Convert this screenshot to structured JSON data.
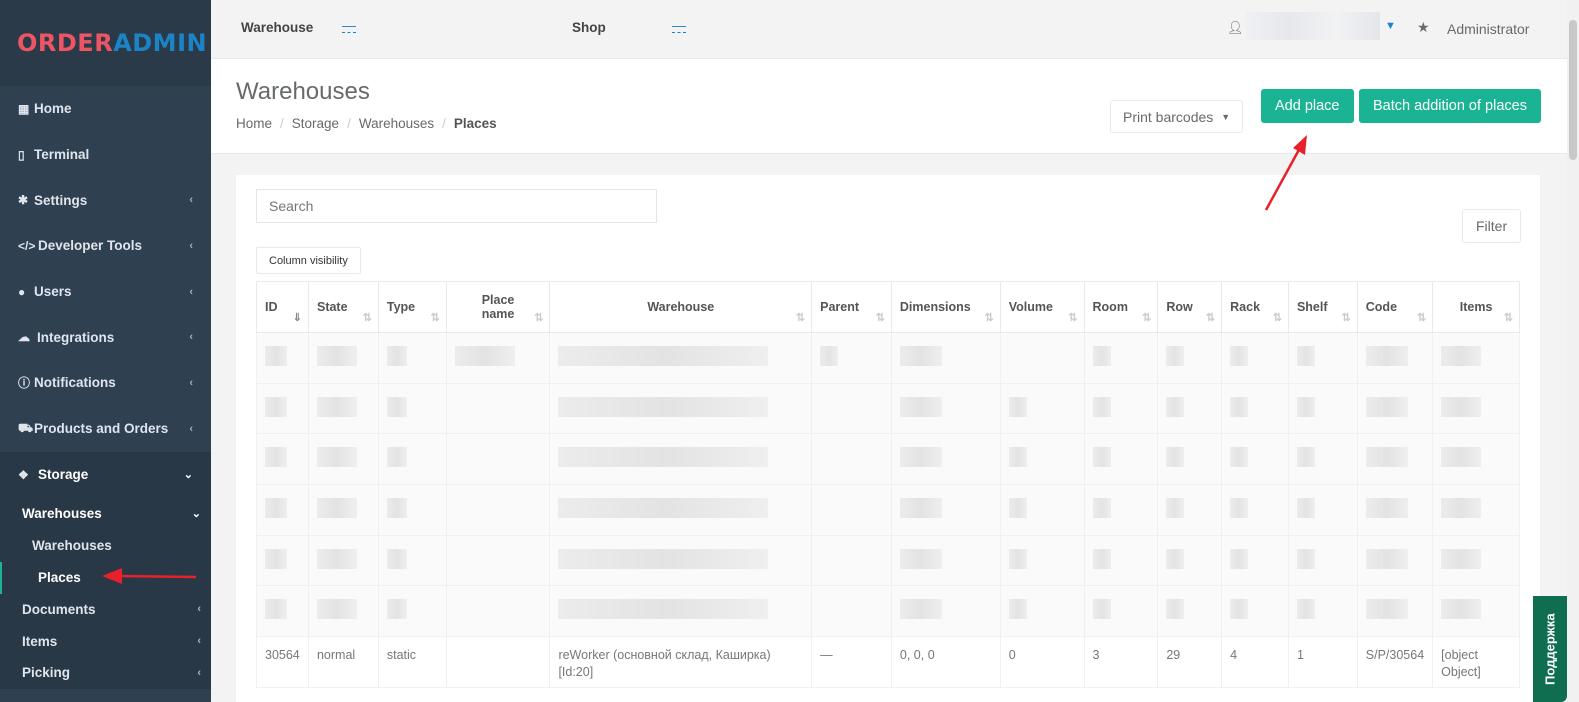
{
  "logo": {
    "part1": "ORDER",
    "part2": "ADMIN"
  },
  "sidebar": {
    "items": [
      {
        "label": "Home",
        "icon": "grid-icon"
      },
      {
        "label": "Terminal",
        "icon": "tablet-icon"
      },
      {
        "label": "Settings",
        "icon": "gear-icon"
      },
      {
        "label": "Developer Tools",
        "icon": "code-icon"
      },
      {
        "label": "Users",
        "icon": "user-icon"
      },
      {
        "label": "Integrations",
        "icon": "cloud-icon"
      },
      {
        "label": "Notifications",
        "icon": "info-icon"
      },
      {
        "label": "Products and Orders",
        "icon": "cart-icon"
      }
    ],
    "storage": {
      "label": "Storage",
      "warehouses_label": "Warehouses",
      "warehouses_link": "Warehouses",
      "places_link": "Places",
      "documents": "Documents",
      "items": "Items",
      "picking": "Picking"
    }
  },
  "topbar": {
    "warehouse_label": "Warehouse",
    "warehouse_value": "—",
    "shop_label": "Shop",
    "shop_value": "—",
    "role": "Administrator"
  },
  "heading": {
    "title": "Warehouses",
    "breadcrumb": [
      "Home",
      "Storage",
      "Warehouses",
      "Places"
    ],
    "print_barcodes": "Print barcodes",
    "add_place": "Add place",
    "batch_add": "Batch addition of places"
  },
  "toolbar": {
    "search_placeholder": "Search",
    "column_visibility": "Column visibility",
    "filter": "Filter"
  },
  "table": {
    "columns": [
      "ID",
      "State",
      "Type",
      "Place name",
      "Warehouse",
      "Parent",
      "Dimensions",
      "Volume",
      "Room",
      "Row",
      "Rack",
      "Shelf",
      "Code",
      "Items"
    ],
    "visible_row": {
      "id": "30564",
      "state": "normal",
      "type": "static",
      "place_name": "",
      "warehouse": "reWorker (основной склад, Каширка) [Id:20]",
      "parent": "—",
      "dimensions": "0, 0, 0",
      "volume": "0",
      "room": "3",
      "row": "29",
      "rack": "4",
      "shelf": "1",
      "code": "S/P/30564",
      "items": "[object Object]"
    }
  },
  "support_tab": "Поддержка",
  "colors": {
    "sidebar": "#2f4050",
    "accent_green": "#1ab394",
    "logo_red": "#ed5565",
    "logo_blue": "#1c84c6",
    "annotation_red": "#e8202a"
  }
}
